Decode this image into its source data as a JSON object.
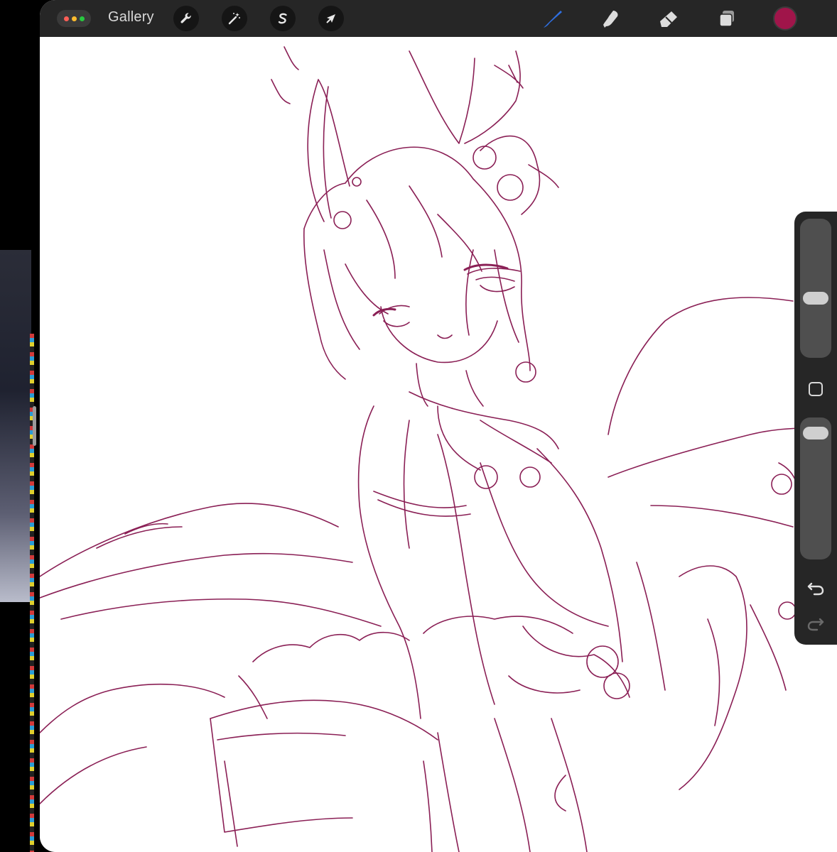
{
  "window": {
    "traffic_light_colors": [
      "#ff5f57",
      "#febc2e",
      "#28c840"
    ]
  },
  "toolbar": {
    "gallery_label": "Gallery",
    "actions_icon": "wrench-icon",
    "adjustments_icon": "magic-wand-icon",
    "selection_icon": "selection-s-icon",
    "transform_icon": "arrow-cursor-icon",
    "tools": [
      {
        "name": "brush",
        "icon": "brush-icon",
        "active": true
      },
      {
        "name": "smudge",
        "icon": "smudge-icon",
        "active": false
      },
      {
        "name": "eraser",
        "icon": "eraser-icon",
        "active": false
      },
      {
        "name": "layers",
        "icon": "layers-icon",
        "active": false
      }
    ],
    "current_color": "#a0154a",
    "active_tool_color": "#2f6fe0"
  },
  "sidebar": {
    "brush_size_level": 0.42,
    "opacity_level": 0.95,
    "modify_icon": "square-icon",
    "undo_icon": "undo-icon",
    "redo_icon": "redo-icon"
  },
  "canvas": {
    "line_color": "#8a1f55"
  }
}
